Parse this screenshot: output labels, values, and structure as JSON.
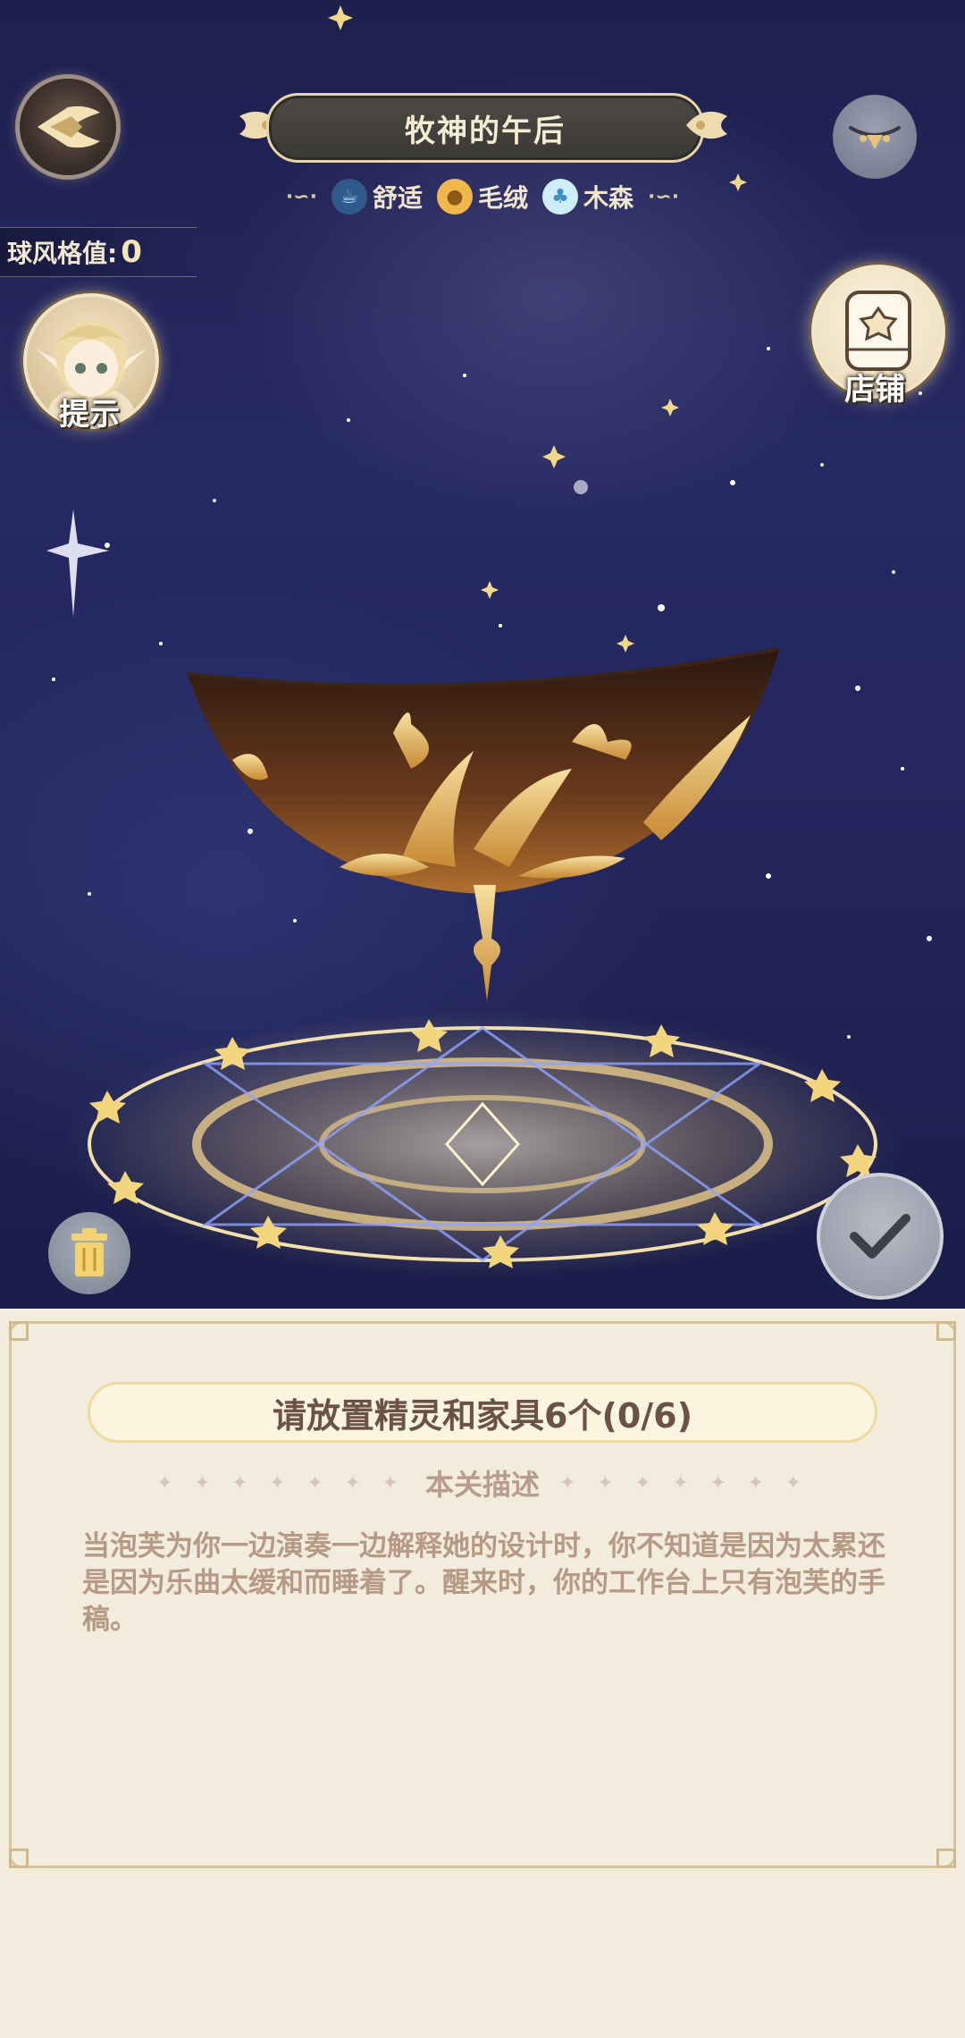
{
  "header": {
    "title": "牧神的午后",
    "back_icon": "wing-back-icon",
    "eye_icon": "closed-eye-icon",
    "tags": [
      {
        "icon": "teacup-icon",
        "label": "舒适",
        "color": "#7fc8e8"
      },
      {
        "icon": "paw-icon",
        "label": "毛绒",
        "color": "#f0b84a"
      },
      {
        "icon": "tree-icon",
        "label": "木森",
        "color": "#8fd0f0"
      }
    ]
  },
  "style_score": {
    "label": "球风格值:",
    "value": "0"
  },
  "hint": {
    "label": "提示"
  },
  "shop": {
    "label": "店铺"
  },
  "task": {
    "text": "请放置精灵和家具6个(0/6)"
  },
  "description": {
    "heading": "本关描述",
    "sparkle_left": "✦ ✦ ✦ ✦ ✦ ✦ ✦",
    "sparkle_right": "✦ ✦ ✦ ✦ ✦ ✦ ✦",
    "text": "当泡芙为你一边演奏一边解释她的设计时，你不知道是因为太累还是因为乐曲太缓和而睡着了。醒来时，你的工作台上只有泡芙的手稿。"
  },
  "colors": {
    "accent_gold": "#e8c77a",
    "panel_bg": "#f2ecdd",
    "title_bg": "#45423d"
  }
}
